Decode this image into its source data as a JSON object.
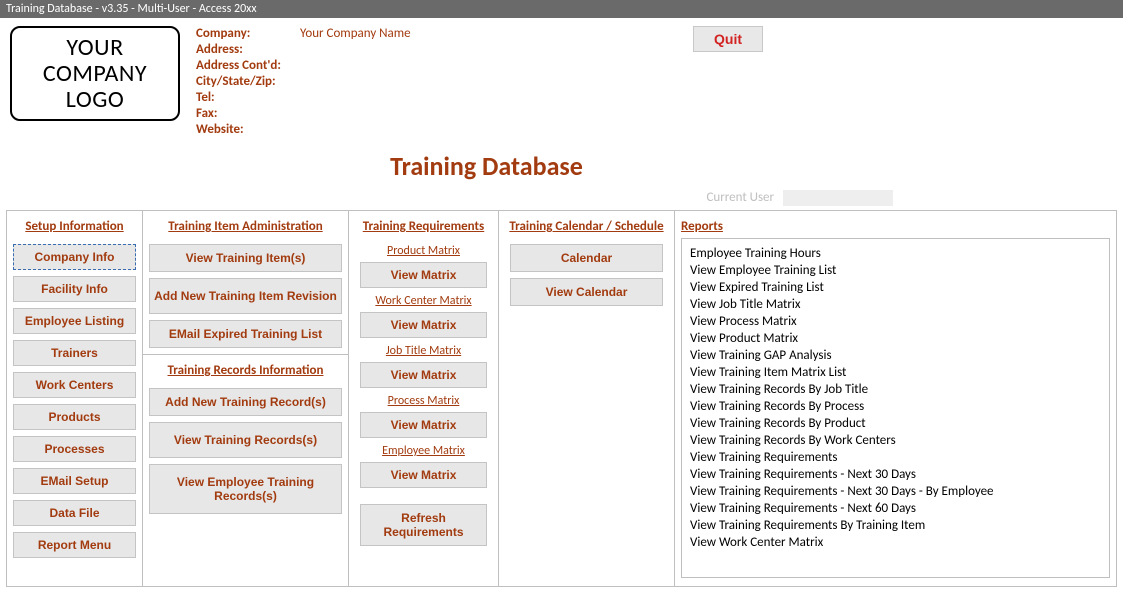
{
  "window": {
    "title": "Training Database - v3.35 - Multi-User - Access 20xx"
  },
  "logo": {
    "line1": "YOUR",
    "line2": "COMPANY",
    "line3": "LOGO"
  },
  "company": {
    "labels": {
      "company": "Company:",
      "address": "Address:",
      "address2": "Address Cont'd:",
      "csz": "City/State/Zip:",
      "tel": "Tel:",
      "fax": "Fax:",
      "website": "Website:"
    },
    "name": "Your Company Name"
  },
  "buttons": {
    "quit": "Quit"
  },
  "main_title": "Training Database",
  "current_user_label": "Current User",
  "current_user_value": "",
  "sections": {
    "setup": {
      "title": "Setup Information",
      "items": [
        "Company Info",
        "Facility Info",
        "Employee Listing",
        "Trainers",
        "Work Centers",
        "Products",
        "Processes",
        "EMail Setup",
        "Data File",
        "Report Menu"
      ]
    },
    "admin": {
      "title": "Training Item Administration",
      "items": [
        "View Training Item(s)",
        "Add New Training Item Revision",
        "EMail Expired Training List"
      ]
    },
    "records": {
      "title": "Training Records Information",
      "items": [
        "Add New Training Record(s)",
        "View Training Records(s)",
        "View Employee Training Records(s)"
      ]
    },
    "requirements": {
      "title": "Training Requirements",
      "groups": [
        {
          "label": "Product Matrix",
          "button": "View Matrix"
        },
        {
          "label": "Work Center Matrix",
          "button": "View Matrix"
        },
        {
          "label": "Job Title Matrix",
          "button": "View Matrix"
        },
        {
          "label": "Process Matrix",
          "button": "View Matrix"
        },
        {
          "label": "Employee Matrix",
          "button": "View Matrix"
        }
      ],
      "refresh": "Refresh Requirements"
    },
    "calendar": {
      "title": "Training Calendar / Schedule",
      "items": [
        "Calendar",
        "View Calendar"
      ]
    },
    "reports": {
      "title": "Reports",
      "items": [
        "Employee Training Hours",
        "View Employee Training List",
        "View Expired Training List",
        "View Job Title Matrix",
        "View Process Matrix",
        "View Product Matrix",
        "View Training GAP Analysis",
        "View Training Item Matrix List",
        "View Training Records By Job Title",
        "View Training Records By Process",
        "View Training Records By Product",
        "View Training Records By Work Centers",
        "View Training Requirements",
        "View Training Requirements - Next 30 Days",
        "View Training Requirements - Next 30 Days - By Employee",
        "View Training Requirements - Next 60 Days",
        "View Training Requirements By Training Item",
        "View Work Center Matrix"
      ]
    }
  }
}
